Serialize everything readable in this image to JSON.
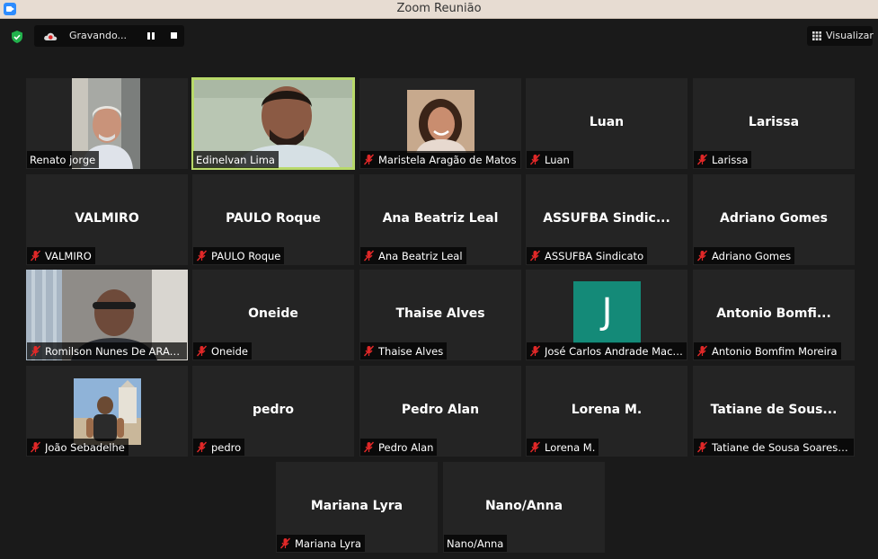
{
  "window": {
    "title": "Zoom Reunião"
  },
  "toolbar": {
    "recording_label": "Gravando...",
    "view_label": "Visualizar"
  },
  "colors": {
    "accent_active": "#b8d96a",
    "mic_muted": "#e02828",
    "avatar_j": "#148a78"
  },
  "participants": [
    {
      "caption": "Renato jorge",
      "big": "",
      "muted": false
    },
    {
      "caption": "Edinelvan Lima",
      "big": "",
      "muted": false,
      "active": true
    },
    {
      "caption": "Maristela Aragão de Matos",
      "big": "",
      "muted": true
    },
    {
      "caption": "Luan",
      "big": "Luan",
      "muted": true
    },
    {
      "caption": "Larissa",
      "big": "Larissa",
      "muted": true
    },
    {
      "caption": "VALMIRO",
      "big": "VALMIRO",
      "muted": true
    },
    {
      "caption": "PAULO Roque",
      "big": "PAULO Roque",
      "muted": true
    },
    {
      "caption": "Ana Beatriz Leal",
      "big": "Ana Beatriz Leal",
      "muted": true
    },
    {
      "caption": "ASSUFBA Sindicato",
      "big": "ASSUFBA  Sindic...",
      "muted": true
    },
    {
      "caption": "Adriano Gomes",
      "big": "Adriano Gomes",
      "muted": true
    },
    {
      "caption": "Romilson Nunes De ARAG...",
      "big": "",
      "muted": true
    },
    {
      "caption": "Oneide",
      "big": "Oneide",
      "muted": true
    },
    {
      "caption": "Thaise Alves",
      "big": "Thaise Alves",
      "muted": true
    },
    {
      "caption": "José Carlos Andrade Mace...",
      "big": "",
      "muted": true,
      "avatar": "J"
    },
    {
      "caption": "Antonio Bomfim Moreira",
      "big": "Antonio  Bomfi...",
      "muted": true
    },
    {
      "caption": "João Sebadelhe",
      "big": "",
      "muted": true
    },
    {
      "caption": "pedro",
      "big": "pedro",
      "muted": true
    },
    {
      "caption": "Pedro Alan",
      "big": "Pedro Alan",
      "muted": true
    },
    {
      "caption": "Lorena M.",
      "big": "Lorena M.",
      "muted": true
    },
    {
      "caption": "Tatiane de Sousa Soares B...",
      "big": "Tatiane  de  Sous...",
      "muted": true
    },
    {
      "caption": "Mariana Lyra",
      "big": "Mariana Lyra",
      "muted": true
    },
    {
      "caption": "Nano/Anna",
      "big": "Nano/Anna",
      "muted": false
    }
  ]
}
